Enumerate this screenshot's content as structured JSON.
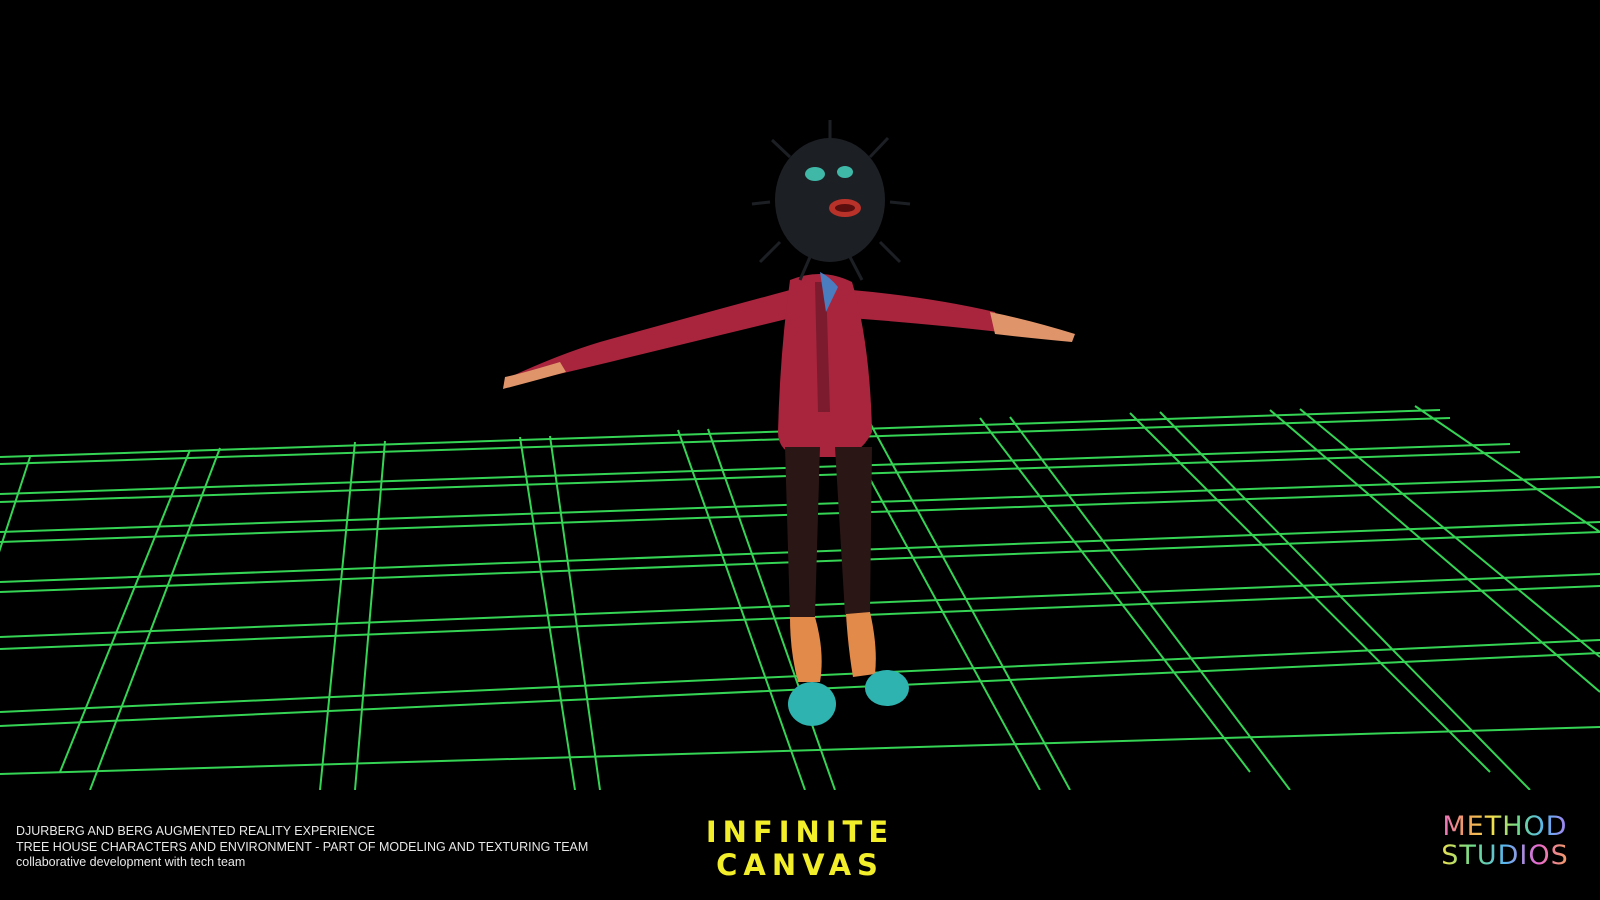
{
  "credits": {
    "line1": "DJURBERG AND BERG AUGMENTED REALITY EXPERIENCE",
    "line2": "TREE HOUSE CHARACTERS AND ENVIRONMENT  -  PART OF MODELING AND TEXTURING TEAM",
    "line3": "collaborative development with tech team"
  },
  "title": {
    "line1": "INFINITE",
    "line2": "CANVAS",
    "color": "#f2ee2a"
  },
  "logo": {
    "line1": "METHOD",
    "line2": "STUDIOS"
  },
  "scene": {
    "grid_color": "#39e05a",
    "background": "#000000",
    "character": {
      "jacket_color": "#a8253d",
      "pants_color": "#2a1614",
      "shoe_color": "#2fb3b0",
      "skin_color": "#e0946a"
    }
  }
}
